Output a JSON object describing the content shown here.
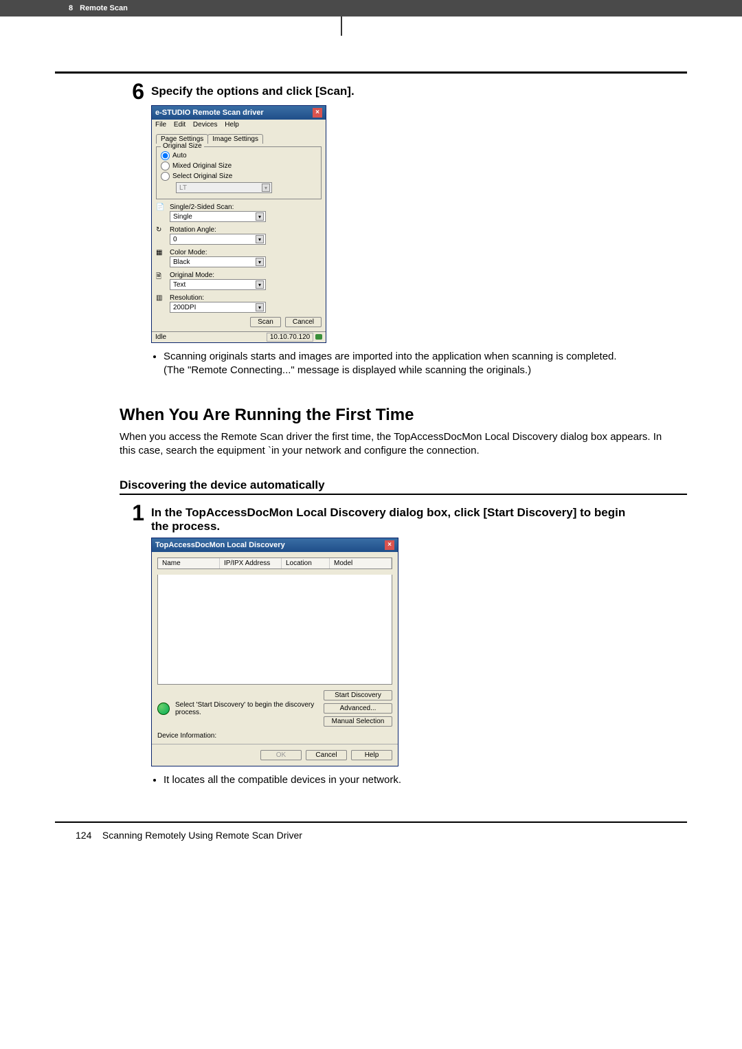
{
  "header": {
    "chapter_num": "8",
    "chapter_title": "Remote Scan"
  },
  "step6": {
    "num": "6",
    "title": "Specify the options and click [Scan]."
  },
  "dialog1": {
    "title": "e-STUDIO Remote Scan driver",
    "menu": {
      "file": "File",
      "edit": "Edit",
      "devices": "Devices",
      "help": "Help"
    },
    "tabs": {
      "page": "Page Settings",
      "image": "Image Settings"
    },
    "group_original": "Original Size",
    "radio_auto": "Auto",
    "radio_mixed": "Mixed Original Size",
    "radio_select": "Select Original Size",
    "select_size_val": "LT",
    "label_sided": "Single/2-Sided Scan:",
    "val_sided": "Single",
    "label_rotation": "Rotation Angle:",
    "val_rotation": "0",
    "label_color": "Color Mode:",
    "val_color": "Black",
    "label_origmode": "Original Mode:",
    "val_origmode": "Text",
    "label_res": "Resolution:",
    "val_res": "200DPI",
    "btn_scan": "Scan",
    "btn_cancel": "Cancel",
    "status_idle": "Idle",
    "status_ip": "10.10.70.120"
  },
  "bullets6": {
    "line1": "Scanning originals starts and images are imported into the application when scanning is completed.",
    "line2": "(The \"Remote Connecting...\" message is displayed while scanning the originals.)"
  },
  "h2": "When You Are Running the First Time",
  "para_intro": "When you access the Remote Scan driver the first time, the TopAccessDocMon Local Discovery dialog box appears.  In this case, search the equipment `in your network and configure the connection.",
  "h3": "Discovering the device automatically",
  "step1": {
    "num": "1",
    "title": "In the TopAccessDocMon Local Discovery dialog box, click [Start Discovery] to begin the process."
  },
  "dialog2": {
    "title": "TopAccessDocMon Local Discovery",
    "col_name": "Name",
    "col_ip": "IP/IPX Address",
    "col_loc": "Location",
    "col_model": "Model",
    "hint": "Select 'Start Discovery' to begin the discovery process.",
    "btn_start": "Start Discovery",
    "btn_adv": "Advanced...",
    "btn_manual": "Manual Selection",
    "devinfo_label": "Device Information:",
    "btn_ok": "OK",
    "btn_cancel": "Cancel",
    "btn_help": "Help"
  },
  "bullets1": {
    "line1": "It locates all the compatible devices in your network."
  },
  "footer": {
    "pagenum": "124",
    "text": "Scanning Remotely Using Remote Scan Driver"
  }
}
